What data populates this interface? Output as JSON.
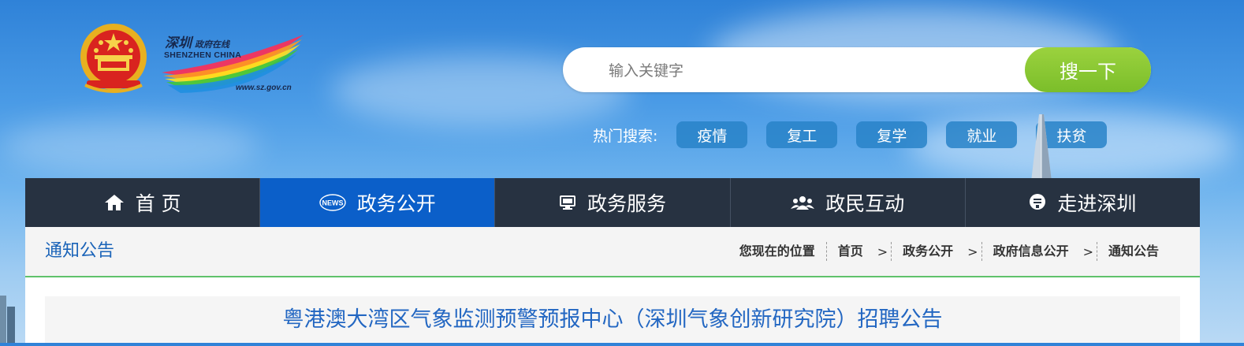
{
  "header": {
    "logo": {
      "cn": "深圳",
      "cn_small": "政府在线",
      "en": "SHENZHEN CHINA",
      "url": "www.sz.gov.cn"
    },
    "search": {
      "placeholder": "输入关键字",
      "button_label": "搜一下"
    },
    "hot_search": {
      "label": "热门搜索:",
      "tags": [
        "疫情",
        "复工",
        "复学",
        "就业",
        "扶贫"
      ]
    }
  },
  "nav": {
    "items": [
      {
        "label": "首 页",
        "icon": "home-icon"
      },
      {
        "label": "政务公开",
        "icon": "news-icon",
        "active": true
      },
      {
        "label": "政务服务",
        "icon": "monitor-icon"
      },
      {
        "label": "政民互动",
        "icon": "users-icon"
      },
      {
        "label": "走进深圳",
        "icon": "info-icon"
      }
    ]
  },
  "content": {
    "section_title": "通知公告",
    "breadcrumb": {
      "prefix": "您现在的位置",
      "items": [
        "首页",
        "政务公开",
        "政府信息公开",
        "通知公告"
      ]
    },
    "article_title": "粤港澳大湾区气象监测预警预报中心（深圳气象创新研究院）招聘公告"
  },
  "colors": {
    "nav_bg": "#273241",
    "nav_active": "#0b5fc9",
    "search_button": "#8cc836",
    "title_blue": "#2367c2",
    "divider_green": "#5fc26b"
  }
}
